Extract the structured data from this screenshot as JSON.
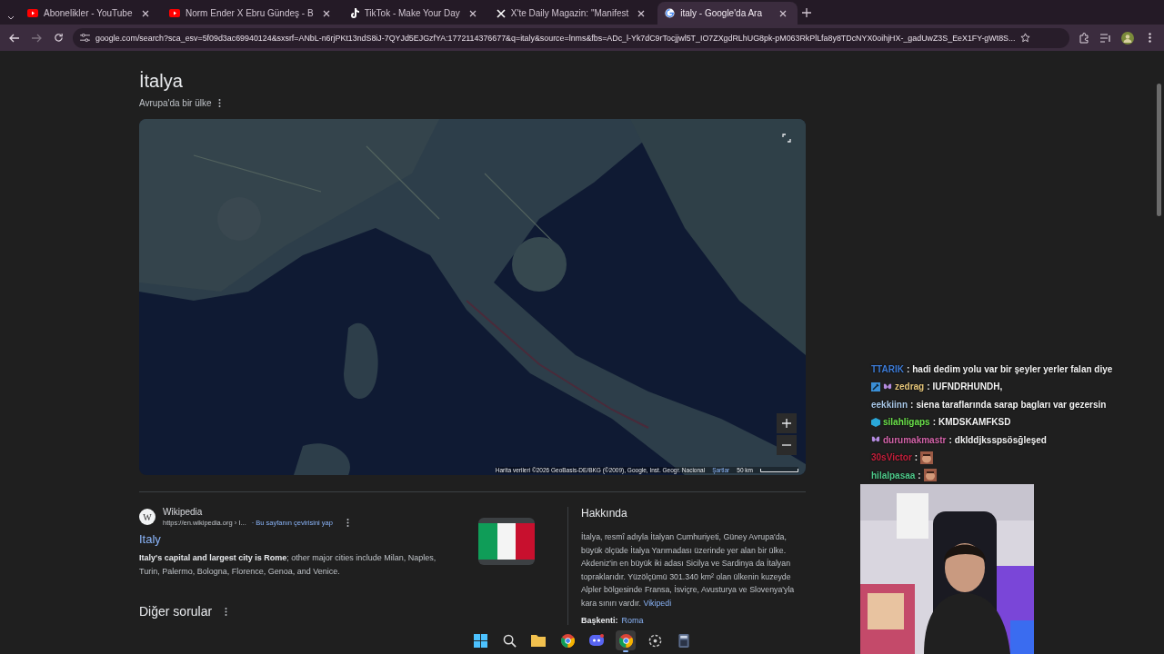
{
  "tabs": [
    {
      "title": "Abonelikler - YouTube",
      "kind": "youtube",
      "selected": false
    },
    {
      "title": "Norm Ender X Ebru Gündeş - B",
      "kind": "youtube",
      "selected": false
    },
    {
      "title": "TikTok - Make Your Day",
      "kind": "tiktok",
      "selected": false
    },
    {
      "title": "X'te Daily Magazin: \"Manifest",
      "kind": "x",
      "selected": false
    },
    {
      "title": "italy - Google'da Ara",
      "kind": "google",
      "selected": true
    }
  ],
  "address": {
    "url": "google.com/search?sca_esv=5f09d3ac69940124&sxsrf=ANbL-n6rjPKt13ndS8iJ-7QYJd5EJGzfYA:1772114376677&q=italy&source=lnms&fbs=ADc_l-Yk7dC9rTocjjwl5T_IO7ZXgdRLhUG8pk-pM063RkPlLfa8y8TDcNYX0oihjHX-_gadUwZ3S_EeX1FY-gWt8S..."
  },
  "knowledge_panel": {
    "title": "İtalya",
    "subtitle": "Avrupa'da bir ülke",
    "map": {
      "kind": "picture",
      "attribution": "Harita verileri ©2026 GeoBasis-DE/BKG (©2009), Google, Inst. Geogr. Nacional",
      "terms": "Şartlar",
      "scale": "50 km"
    }
  },
  "result": {
    "source": "Wikipedia",
    "favicon": "W",
    "url": "https://en.wikipedia.org › I...",
    "translate": "· Bu sayfanın çevirisini yap",
    "title": "Italy",
    "snippet": "**Italy's capital and largest city is Rome**; other major cities include Milan, Naples, Turin, Palermo, Bologna, Florence, Genoa, and Venice."
  },
  "more_questions": "Diğer sorular",
  "about": {
    "heading": "Hakkında",
    "text": "İtalya, resmî adıyla İtalyan Cumhuriyeti, Güney Avrupa'da, büyük ölçüde İtalya Yarımadası üzerinde yer alan bir ülke. Akdeniz'in en büyük iki adası Sicilya ve Sardinya da İtalyan topraklarıdır. Yüzölçümü 301.340 km² olan ülkenin kuzeyde Alpler bölgesinde Fransa, İsviçre, Avusturya ve Slovenya'yla kara sınırı vardır.",
    "link": "Vikipedi",
    "capital_label": "Başkenti:",
    "capital": "Roma"
  },
  "chat": [
    {
      "user": "TTARIK",
      "color": "#3d7bd6",
      "separator": ":",
      "kind": "text",
      "message": "hadi dedim yolu var bir şeyler yerler falan diye"
    },
    {
      "user": "zedrag",
      "color": "#e6c67a",
      "badges": [
        {
          "kind": "tool"
        },
        {
          "kind": "butterfly"
        }
      ],
      "separator": ":",
      "kind": "text",
      "message": "IUFNDRHUNDH,"
    },
    {
      "user": "eekkiinn",
      "color": "#a9c8e8",
      "separator": ":",
      "kind": "text",
      "message": "siena taraflarında sarap bagları var gezersin"
    },
    {
      "user": "silahligaps",
      "color": "#6be04b",
      "badges": [
        {
          "kind": "cube"
        }
      ],
      "separator": ":",
      "kind": "text",
      "message": "KMDSKAMFKSD"
    },
    {
      "user": "durumakmastr",
      "color": "#d263a8",
      "badges": [
        {
          "kind": "butterfly"
        }
      ],
      "separator": ":",
      "kind": "text",
      "message": "dklddjksspsösğleşed"
    },
    {
      "user": "30sVictor",
      "color": "#c4203c",
      "separator": ":",
      "kind": "emote"
    },
    {
      "user": "hilalpasaa",
      "color": "#4ec98a",
      "separator": ":",
      "kind": "emote"
    }
  ],
  "taskbar": [
    {
      "kind": "windows",
      "active": false
    },
    {
      "kind": "search",
      "active": false
    },
    {
      "kind": "folder",
      "active": false
    },
    {
      "kind": "chrome",
      "active": false
    },
    {
      "kind": "discord",
      "active": false
    },
    {
      "kind": "chrome",
      "active": true
    },
    {
      "kind": "steam",
      "active": false
    },
    {
      "kind": "calculator",
      "active": false
    }
  ]
}
